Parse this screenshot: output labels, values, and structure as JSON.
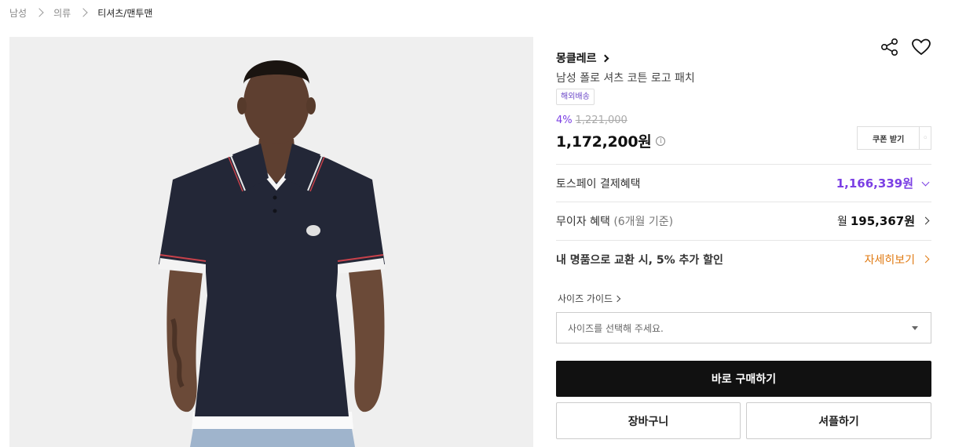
{
  "breadcrumb": {
    "items": [
      "남성",
      "의류",
      "티셔츠/맨투맨"
    ]
  },
  "product": {
    "brand": "몽클레르",
    "name": "남성 폴로 셔츠 코튼 로고 패치",
    "tag": "해외배송",
    "discount_rate": "4%",
    "original_price": "1,221,000",
    "price": "1,172,200원",
    "info_icon": "i",
    "coupon_label": "쿠폰 받기"
  },
  "benefits": {
    "tosspay_label": "토스페이 결제혜택",
    "tosspay_value": "1,166,339원",
    "installment_label": "무이자 혜택",
    "installment_note": "(6개월 기준)",
    "installment_prefix": "월",
    "installment_value": "195,367원",
    "tradein_label": "내 명품으로 교환 시, 5% 추가 할인",
    "tradein_link": "자세히보기"
  },
  "size": {
    "guide_label": "사이즈 가이드",
    "placeholder": "사이즈를 선택해 주세요."
  },
  "actions": {
    "buy_label": "바로 구매하기",
    "cart_label": "장바구니",
    "sample_label": "셔플하기"
  },
  "colors": {
    "accent_purple": "#7b3fe4",
    "accent_orange": "#e07a12",
    "primary_button": "#111111"
  },
  "icons": {
    "share": "share-icon",
    "wishlist": "heart-icon"
  }
}
